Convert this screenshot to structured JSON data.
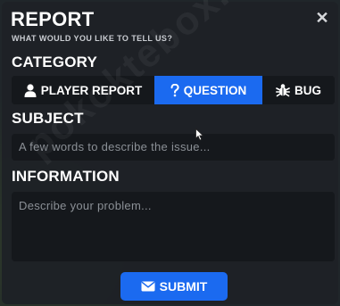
{
  "header": {
    "title": "REPORT",
    "subtitle": "WHAT WOULD YOU LIKE TO TELL US?",
    "close_glyph": "✕"
  },
  "category": {
    "label": "CATEGORY",
    "tabs": [
      {
        "label": "PLAYER REPORT",
        "icon": "person-icon",
        "selected": false
      },
      {
        "label": "QUESTION",
        "icon": "question-icon",
        "selected": true
      },
      {
        "label": "BUG",
        "icon": "bug-icon",
        "selected": false
      }
    ]
  },
  "subject": {
    "label": "SUBJECT",
    "placeholder": "A few words to describe the issue..."
  },
  "information": {
    "label": "INFORMATION",
    "placeholder": "Describe your problem..."
  },
  "submit": {
    "label": "SUBMIT",
    "icon": "envelope-icon"
  },
  "watermark": {
    "text": "pokoktebox.io"
  },
  "colors": {
    "accent": "#1b6af0",
    "panel": "#1e2126",
    "field": "#15181c"
  }
}
